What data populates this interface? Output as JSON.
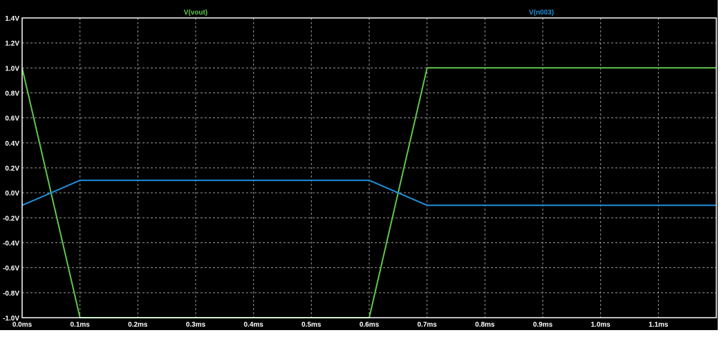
{
  "chart_data": {
    "type": "line",
    "title": "",
    "xlabel": "",
    "ylabel": "",
    "xlim": [
      0.0,
      1.2
    ],
    "ylim": [
      -1.0,
      1.4
    ],
    "grid": true,
    "background": "#000000",
    "axis_color": "#ffffff",
    "grid_color": "#9a9a9a",
    "x_ticks": [
      {
        "value": 0.0,
        "label": "0.0ms"
      },
      {
        "value": 0.1,
        "label": "0.1ms"
      },
      {
        "value": 0.2,
        "label": "0.2ms"
      },
      {
        "value": 0.3,
        "label": "0.3ms"
      },
      {
        "value": 0.4,
        "label": "0.4ms"
      },
      {
        "value": 0.5,
        "label": "0.5ms"
      },
      {
        "value": 0.6,
        "label": "0.6ms"
      },
      {
        "value": 0.7,
        "label": "0.7ms"
      },
      {
        "value": 0.8,
        "label": "0.8ms"
      },
      {
        "value": 0.9,
        "label": "0.9ms"
      },
      {
        "value": 1.0,
        "label": "1.0ms"
      },
      {
        "value": 1.1,
        "label": "1.1ms"
      }
    ],
    "y_ticks": [
      {
        "value": 1.4,
        "label": "1.4V"
      },
      {
        "value": 1.2,
        "label": "1.2V"
      },
      {
        "value": 1.0,
        "label": "1.0V"
      },
      {
        "value": 0.8,
        "label": "0.8V"
      },
      {
        "value": 0.6,
        "label": "0.6V"
      },
      {
        "value": 0.4,
        "label": "0.4V"
      },
      {
        "value": 0.2,
        "label": "0.2V"
      },
      {
        "value": 0.0,
        "label": "0.0V"
      },
      {
        "value": -0.2,
        "label": "-0.2V"
      },
      {
        "value": -0.4,
        "label": "-0.4V"
      },
      {
        "value": -0.6,
        "label": "-0.6V"
      },
      {
        "value": -0.8,
        "label": "-0.8V"
      },
      {
        "value": -1.0,
        "label": "-1.0V"
      }
    ],
    "series": [
      {
        "name": "V(vout)",
        "color": "#5fc84a",
        "x": [
          0.0,
          0.1,
          0.6,
          0.7,
          1.2
        ],
        "y": [
          1.0,
          -1.0,
          -1.0,
          1.0,
          1.0
        ]
      },
      {
        "name": "V(n003)",
        "color": "#1f8fd8",
        "x": [
          0.0,
          0.1,
          0.6,
          0.7,
          1.2
        ],
        "y": [
          -0.1,
          0.1,
          0.1,
          -0.1,
          -0.1
        ]
      }
    ]
  }
}
